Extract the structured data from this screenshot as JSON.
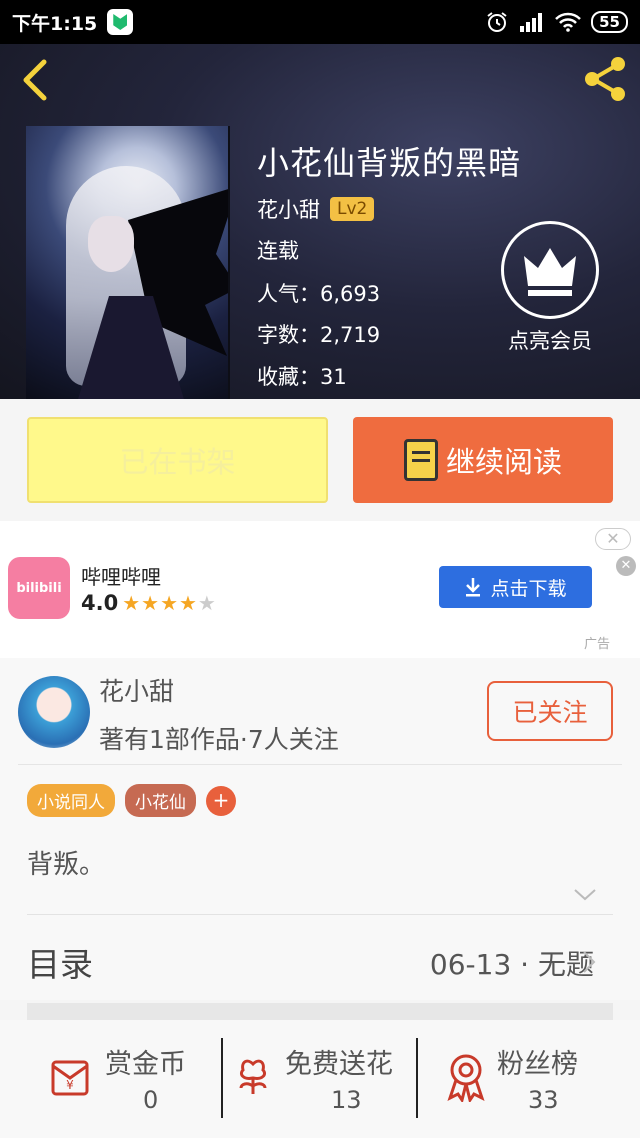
{
  "status_bar": {
    "time": "下午1:15",
    "battery": "55"
  },
  "book": {
    "title": "小花仙背叛的黑暗",
    "author": "花小甜",
    "level": "Lv2",
    "status": "连载",
    "popularity": "人气：6,693",
    "word_count": "字数：2,719",
    "favorites": "收藏：31",
    "vip_label": "点亮会员"
  },
  "actions": {
    "on_shelf": "已在书架",
    "continue_reading": "继续阅读"
  },
  "ad": {
    "app_logo_text": "bilibili",
    "app_name": "哔哩哔哩",
    "rating": "4.0",
    "stars_filled": 4,
    "stars_total": 5,
    "download_label": "点击下载",
    "ad_tag": "广告",
    "close_symbol": "✕"
  },
  "author_card": {
    "name": "花小甜",
    "subtitle": "著有1部作品·7人关注",
    "follow_label": "已关注",
    "tags": [
      {
        "label": "小说同人",
        "color": "#f2a93a"
      },
      {
        "label": "小花仙",
        "color": "#c66a52"
      }
    ],
    "add_tag_symbol": "+",
    "description": "背叛。"
  },
  "toc": {
    "label": "目录",
    "latest": "06-13 · 无题"
  },
  "stats": {
    "reward": {
      "label": "赏金币",
      "value": "0"
    },
    "flowers": {
      "label": "免费送花",
      "value": "13"
    },
    "fans": {
      "label": "粉丝榜",
      "value": "33"
    }
  },
  "colors": {
    "accent_orange": "#ef6c3f",
    "shelf_yellow": "#fff98b",
    "download_blue": "#2d6ee0",
    "icon_red": "#c83a2a"
  }
}
